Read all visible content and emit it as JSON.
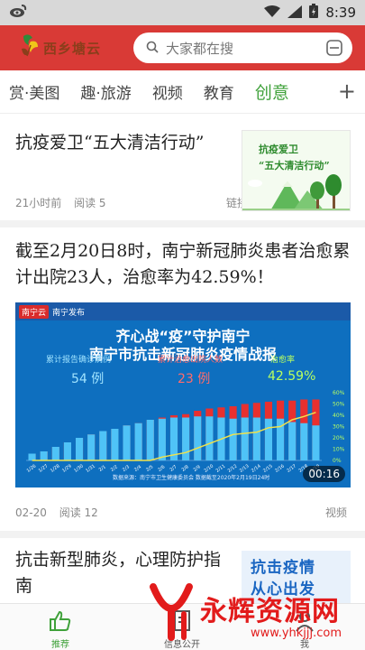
{
  "status_bar": {
    "time": "8:39"
  },
  "header": {
    "logo_text": "西乡塘云",
    "search_placeholder": "大家都在搜"
  },
  "tabs": [
    "赏·美图",
    "趣·旅游",
    "视频",
    "教育",
    "创意"
  ],
  "articles": [
    {
      "title": "抗疫爱卫“五大清洁行动”",
      "time": "21小时前",
      "reads": "阅读 5",
      "type": "链接",
      "thumb_line1": "抗疫爱卫",
      "thumb_line2": "“五大清洁行动”"
    },
    {
      "title": "截至2月20日8时，南宁新冠肺炎患者治愈累计出院23人，治愈率为42.59%！",
      "time": "02-20",
      "reads": "阅读 12",
      "type": "视频",
      "video": {
        "brand1": "南宁云",
        "brand2": "南宁发布",
        "headline1": "齐心战“疫”守护南宁",
        "headline2": "南宁市抗击新冠肺炎疫情战报",
        "stat1_label": "累计报告确诊病例",
        "stat1_value": "54 例",
        "stat2_label": "累计治愈出院人数",
        "stat2_value": "23 例",
        "stat3_label": "治愈率",
        "stat3_value": "42.59%",
        "footer": "数据来源：南宁市卫生健康委员会  数据截至2020年2月19日24时",
        "duration": "00:16"
      }
    },
    {
      "title": "抗击新型肺炎，心理防护指南",
      "thumb_line1": "抗击疫情",
      "thumb_line2": "从心出发"
    }
  ],
  "chart_data": {
    "type": "bar",
    "title": "南宁市抗击新冠肺炎疫情战报",
    "categories": [
      "1/26",
      "1/27",
      "1/28",
      "1/29",
      "1/30",
      "1/31",
      "2/1",
      "2/2",
      "2/3",
      "2/4",
      "2/5",
      "2/6",
      "2/7",
      "2/8",
      "2/9",
      "2/10",
      "2/11",
      "2/12",
      "2/13",
      "2/14",
      "2/15",
      "2/16",
      "2/17",
      "2/18",
      "2/19"
    ],
    "series": [
      {
        "name": "累计报告确诊病例",
        "values": [
          6,
          8,
          12,
          16,
          20,
          23,
          26,
          28,
          31,
          33,
          36,
          38,
          40,
          41,
          44,
          46,
          47,
          48,
          50,
          51,
          52,
          53,
          53,
          54,
          54
        ]
      },
      {
        "name": "累计治愈出院人数",
        "values": [
          0,
          0,
          0,
          0,
          0,
          0,
          0,
          0,
          0,
          0,
          0,
          1,
          2,
          3,
          5,
          7,
          9,
          11,
          12,
          13,
          15,
          16,
          19,
          21,
          23
        ]
      },
      {
        "name": "治愈率",
        "values": [
          0,
          0,
          0,
          0,
          0,
          0,
          0,
          0,
          0,
          0,
          0,
          3,
          5,
          7,
          11,
          15,
          19,
          23,
          24,
          25,
          29,
          30,
          36,
          39,
          42.59
        ]
      }
    ],
    "ylim": [
      0,
      60
    ],
    "y2_ticks": [
      "0%",
      "10%",
      "20%",
      "30%",
      "40%",
      "50%",
      "60%"
    ],
    "colors": {
      "confirmed": "#e8302f",
      "cured": "#4fc3f7",
      "rate": "#f2e24a"
    }
  },
  "bottom_nav": [
    {
      "label": "推荐",
      "icon": "thumbs-up-icon"
    },
    {
      "label": "信息公开",
      "icon": "document-icon"
    },
    {
      "label": "我",
      "icon": "user-icon"
    }
  ],
  "watermark": {
    "text": "永辉资源网",
    "url": "www.yhkjjj.com"
  }
}
